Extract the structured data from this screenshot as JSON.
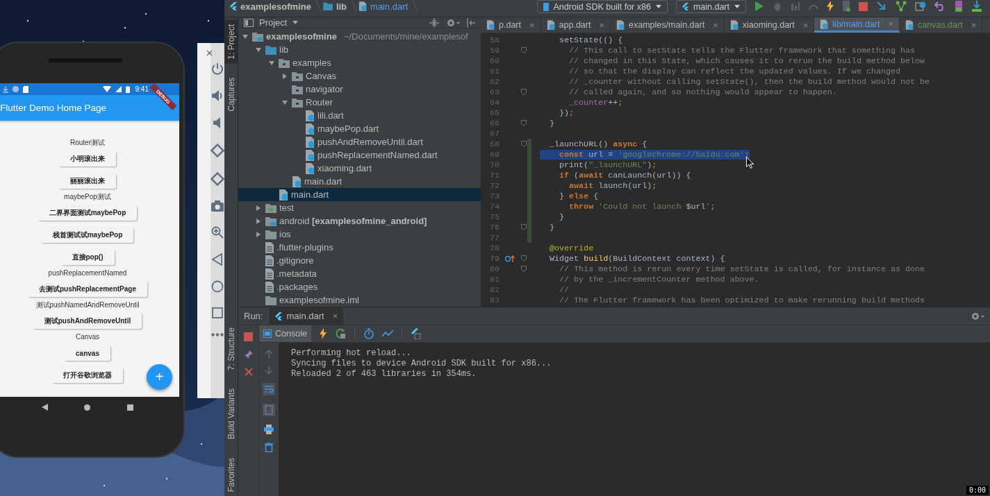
{
  "emulator": {
    "status_time": "9:41",
    "debug_banner": "DEBUG",
    "app_bar_title": "Flutter Demo Home Page",
    "items": [
      {
        "kind": "label",
        "text": "Router测试"
      },
      {
        "kind": "button",
        "text": "小明滚出来"
      },
      {
        "kind": "button",
        "text": "丽丽滚出来"
      },
      {
        "kind": "label",
        "text": "maybePop测试"
      },
      {
        "kind": "button",
        "text": "二界界面测试maybePop"
      },
      {
        "kind": "button",
        "text": "栈首测试试maybePop"
      },
      {
        "kind": "button",
        "text": "直接pop()"
      },
      {
        "kind": "label",
        "text": "pushReplacementNamed"
      },
      {
        "kind": "button",
        "text": "去测试pushReplacementPage"
      },
      {
        "kind": "label",
        "text": "测试pushNamedAndRemoveUntil"
      },
      {
        "kind": "button",
        "text": "测试pushAndRemoveUntil"
      },
      {
        "kind": "label",
        "text": "Canvas"
      },
      {
        "kind": "button",
        "text": "canvas"
      },
      {
        "kind": "button",
        "text": "打开谷歌浏览器"
      }
    ],
    "fab": "+"
  },
  "ide": {
    "breadcrumbs": [
      "examplesofmine",
      "lib",
      "main.dart"
    ],
    "device": "Android SDK built for x86",
    "run_config": "main.dart",
    "tool_tabs_top": [
      {
        "label": "1: Project",
        "selected": true
      },
      {
        "label": "Captures",
        "selected": false
      }
    ],
    "tool_tabs_bottom": [
      {
        "label": "7: Structure",
        "selected": false
      },
      {
        "label": "Build Variants",
        "selected": false
      },
      {
        "label": "Favorites",
        "selected": false
      }
    ],
    "project": {
      "title": "Project",
      "tree": [
        {
          "name": "examplesofmine",
          "kind": "module",
          "path": "~/Documents/mine/examplesof",
          "expanded": true,
          "selected": false,
          "children": [
            {
              "name": "lib",
              "kind": "source",
              "expanded": true,
              "selected": false,
              "children": [
                {
                  "name": "examples",
                  "kind": "package",
                  "expanded": true,
                  "selected": false,
                  "children": [
                    {
                      "name": "Canvas",
                      "kind": "package",
                      "expanded": false,
                      "selected": false
                    },
                    {
                      "name": "navigator",
                      "kind": "package",
                      "selected": false
                    },
                    {
                      "name": "Router",
                      "kind": "package",
                      "expanded": true,
                      "selected": false,
                      "children": [
                        {
                          "name": "lili.dart",
                          "kind": "dart",
                          "selected": false
                        },
                        {
                          "name": "maybePop.dart",
                          "kind": "dart",
                          "selected": false
                        },
                        {
                          "name": "pushAndRemoveUntil.dart",
                          "kind": "dart",
                          "selected": false
                        },
                        {
                          "name": "pushReplacementNamed.dart",
                          "kind": "dart",
                          "selected": false
                        },
                        {
                          "name": "xiaoming.dart",
                          "kind": "dart",
                          "selected": false
                        }
                      ]
                    },
                    {
                      "name": "main.dart",
                      "kind": "dart",
                      "selected": false
                    }
                  ]
                },
                {
                  "name": "main.dart",
                  "kind": "dart",
                  "selected": true
                }
              ]
            },
            {
              "name": "test",
              "kind": "test",
              "expanded": false,
              "selected": false
            },
            {
              "name": "android **[examplesofmine_android]**",
              "kind": "module",
              "expanded": false,
              "selected": false
            },
            {
              "name": "ios",
              "kind": "folder",
              "expanded": false,
              "selected": false
            },
            {
              "name": ".flutter-plugins",
              "kind": "file",
              "selected": false
            },
            {
              "name": ".gitignore",
              "kind": "file",
              "selected": false
            },
            {
              "name": ".metadata",
              "kind": "file",
              "selected": false
            },
            {
              "name": ".packages",
              "kind": "file",
              "selected": false
            },
            {
              "name": "examplesofmine.iml",
              "kind": "folder",
              "selected": false
            }
          ]
        }
      ]
    },
    "editor_tabs": [
      {
        "label": "p.dart",
        "close": "×",
        "color": "#bbbbbb",
        "selected": false
      },
      {
        "label": "app.dart",
        "close": "×",
        "color": "#bbbbbb",
        "selected": false
      },
      {
        "label": "examples/main.dart",
        "close": "×",
        "color": "#bbbbbb",
        "selected": false
      },
      {
        "label": "xiaoming.dart",
        "close": "×",
        "color": "#bbbbbb",
        "selected": false
      },
      {
        "label": "lib/main.dart",
        "close": "×",
        "color": "#589df6",
        "selected": true
      },
      {
        "label": "canvas.dart",
        "close": "×",
        "color": "#629755",
        "selected": false
      }
    ],
    "code": [
      {
        "number": "58",
        "selected": false,
        "changed": false,
        "tokens": [
          {
            "kind": "plain",
            "text": "    setState(() {"
          }
        ]
      },
      {
        "number": "59",
        "selected": false,
        "changed": false,
        "fold": true,
        "tokens": [
          {
            "kind": "comment",
            "text": "      // This call to setState tells the Flutter framework that something has"
          }
        ]
      },
      {
        "number": "60",
        "selected": false,
        "changed": false,
        "tokens": [
          {
            "kind": "comment",
            "text": "      // changed in this State, which causes it to rerun the build method below"
          }
        ]
      },
      {
        "number": "61",
        "selected": false,
        "changed": false,
        "tokens": [
          {
            "kind": "comment",
            "text": "      // so that the display can reflect the updated values. If we changed"
          }
        ]
      },
      {
        "number": "62",
        "selected": false,
        "changed": false,
        "tokens": [
          {
            "kind": "comment",
            "text": "      // _counter without calling setState(), then the build method would not be"
          }
        ]
      },
      {
        "number": "63",
        "selected": false,
        "changed": false,
        "fold": true,
        "tokens": [
          {
            "kind": "comment",
            "text": "      // called again, and so nothing would appear to happen."
          }
        ]
      },
      {
        "number": "64",
        "selected": false,
        "changed": false,
        "tokens": [
          {
            "kind": "field",
            "text": "      _counter"
          },
          {
            "kind": "plain",
            "text": "++"
          },
          {
            "kind": "keyword",
            "text": ";"
          }
        ]
      },
      {
        "number": "65",
        "selected": false,
        "changed": false,
        "tokens": [
          {
            "kind": "plain",
            "text": "    })"
          },
          {
            "kind": "keyword",
            "text": ";"
          }
        ]
      },
      {
        "number": "66",
        "selected": false,
        "changed": false,
        "fold": true,
        "tokens": [
          {
            "kind": "plain",
            "text": "  }"
          }
        ]
      },
      {
        "number": "67",
        "selected": false,
        "changed": false
      },
      {
        "number": "68",
        "selected": false,
        "changed": true,
        "fold": true,
        "tokens": [
          {
            "kind": "plain",
            "text": "  _launchURL() "
          },
          {
            "kind": "keyword",
            "text": "async"
          },
          {
            "kind": "plain",
            "text": " {"
          }
        ]
      },
      {
        "number": "69",
        "selected": true,
        "changed": true,
        "tokens": [
          {
            "kind": "keyword",
            "text": "    const"
          },
          {
            "kind": "plain",
            "text": " url = "
          },
          {
            "kind": "string",
            "text": "'googlechrome://baidu.com'"
          },
          {
            "kind": "keyword",
            "text": ";"
          }
        ]
      },
      {
        "number": "70",
        "selected": false,
        "changed": true,
        "tokens": [
          {
            "kind": "plain",
            "text": "    print("
          },
          {
            "kind": "string",
            "text": "\"_launchURL\""
          },
          {
            "kind": "plain",
            "text": ")"
          },
          {
            "kind": "keyword",
            "text": ";"
          }
        ]
      },
      {
        "number": "71",
        "selected": false,
        "changed": true,
        "tokens": [
          {
            "kind": "keyword",
            "text": "    if"
          },
          {
            "kind": "plain",
            "text": " ("
          },
          {
            "kind": "keyword",
            "text": "await"
          },
          {
            "kind": "plain",
            "text": " canLaunch(url)) {"
          }
        ]
      },
      {
        "number": "72",
        "selected": false,
        "changed": true,
        "tokens": [
          {
            "kind": "keyword",
            "text": "      await"
          },
          {
            "kind": "plain",
            "text": " launch(url)"
          },
          {
            "kind": "keyword",
            "text": ";"
          }
        ]
      },
      {
        "number": "73",
        "selected": false,
        "changed": true,
        "tokens": [
          {
            "kind": "plain",
            "text": "    } "
          },
          {
            "kind": "keyword",
            "text": "else"
          },
          {
            "kind": "plain",
            "text": " {"
          }
        ]
      },
      {
        "number": "74",
        "selected": false,
        "changed": true,
        "tokens": [
          {
            "kind": "keyword",
            "text": "      throw"
          },
          {
            "kind": "string",
            "text": " 'Could not launch "
          },
          {
            "kind": "plain",
            "text": "$url"
          },
          {
            "kind": "string",
            "text": "'"
          },
          {
            "kind": "keyword",
            "text": ";"
          }
        ]
      },
      {
        "number": "75",
        "selected": false,
        "changed": true,
        "tokens": [
          {
            "kind": "plain",
            "text": "    }"
          }
        ]
      },
      {
        "number": "76",
        "selected": false,
        "changed": true,
        "fold": true,
        "tokens": [
          {
            "kind": "plain",
            "text": "  }"
          }
        ]
      },
      {
        "number": "77",
        "selected": false,
        "changed": true
      },
      {
        "number": "78",
        "selected": false,
        "changed": false,
        "tokens": [
          {
            "kind": "annotation",
            "text": "  @override"
          }
        ]
      },
      {
        "number": "79",
        "selected": false,
        "changed": false,
        "fold": true,
        "override": true,
        "tokens": [
          {
            "kind": "plain",
            "text": "  Widget "
          },
          {
            "kind": "function",
            "text": "build"
          },
          {
            "kind": "plain",
            "text": "(BuildContext context) {"
          }
        ]
      },
      {
        "number": "80",
        "selected": false,
        "changed": false,
        "fold": true,
        "tokens": [
          {
            "kind": "comment",
            "text": "    // This method is rerun every time setState is called, for instance as done"
          }
        ]
      },
      {
        "number": "81",
        "selected": false,
        "changed": false,
        "tokens": [
          {
            "kind": "comment",
            "text": "    // by the _incrementCounter method above."
          }
        ]
      },
      {
        "number": "82",
        "selected": false,
        "changed": false,
        "tokens": [
          {
            "kind": "comment",
            "text": "    //"
          }
        ]
      },
      {
        "number": "83",
        "selected": false,
        "changed": false,
        "tokens": [
          {
            "kind": "comment",
            "text": "    // The Flutter framework has been optimized to make rerunning build methods"
          }
        ]
      }
    ],
    "run": {
      "label": "Run:",
      "tab": "main.dart",
      "tab_close": "×",
      "console_tab": "Console",
      "console": [
        "Performing hot reload...",
        "Syncing files to device Android SDK built for x86...",
        "Reloaded 2 of 463 libraries in 354ms."
      ]
    }
  },
  "video_time": "0:00"
}
